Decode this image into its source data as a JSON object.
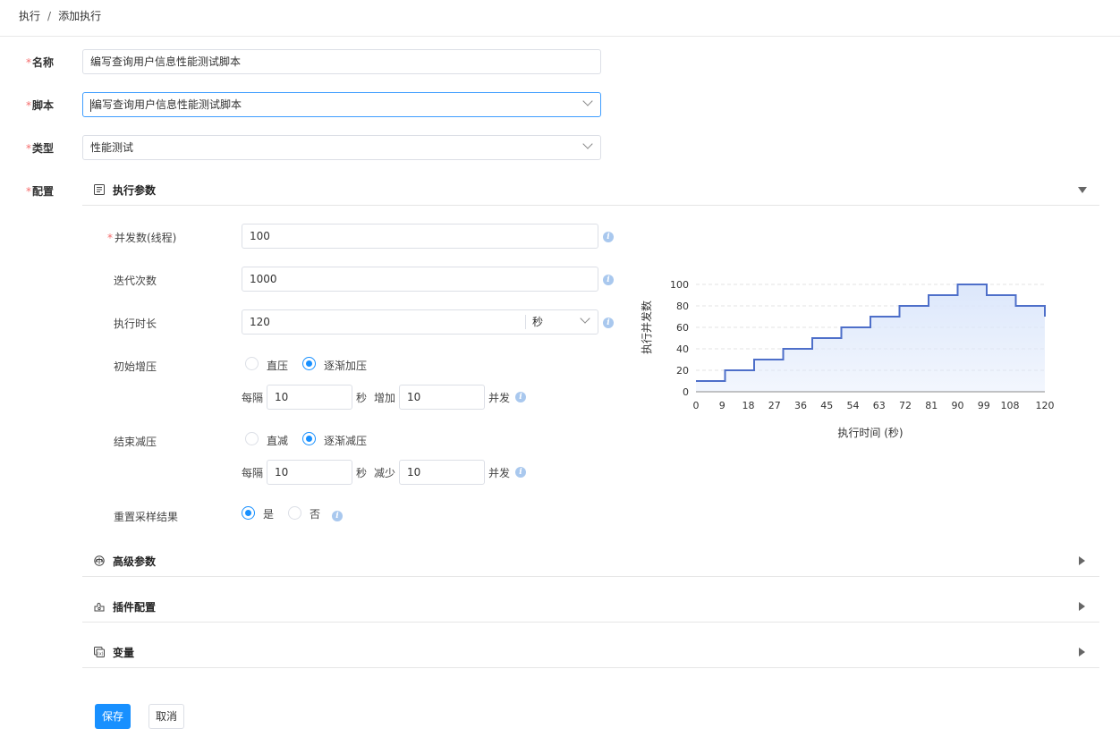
{
  "breadcrumb": {
    "parent": "执行",
    "separator": "/",
    "current": "添加执行"
  },
  "form": {
    "name_label": "名称",
    "name_value": "编写查询用户信息性能测试脚本",
    "script_label": "脚本",
    "script_value": "编写查询用户信息性能测试脚本",
    "type_label": "类型",
    "type_value": "性能测试",
    "config_label": "配置"
  },
  "sections": {
    "exec_params": "执行参数",
    "advanced": "高级参数",
    "plugins": "插件配置",
    "variables": "变量"
  },
  "exec": {
    "concurrency_label": "并发数(线程)",
    "concurrency_value": "100",
    "iterations_label": "迭代次数",
    "iterations_value": "1000",
    "duration_label": "执行时长",
    "duration_value": "120",
    "duration_unit": "秒",
    "ramp_up_label": "初始增压",
    "ramp_up_opt_direct": "直压",
    "ramp_up_opt_gradual": "逐渐加压",
    "ramp_up_every": "每隔",
    "ramp_up_every_value": "10",
    "ramp_up_sec": "秒",
    "ramp_up_add": "增加",
    "ramp_up_add_value": "10",
    "ramp_up_concurrent": "并发",
    "ramp_down_label": "结束减压",
    "ramp_down_opt_direct": "直减",
    "ramp_down_opt_gradual": "逐渐减压",
    "ramp_down_every": "每隔",
    "ramp_down_every_value": "10",
    "ramp_down_sec": "秒",
    "ramp_down_reduce": "减少",
    "ramp_down_reduce_value": "10",
    "ramp_down_concurrent": "并发",
    "reset_label": "重置采样结果",
    "reset_yes": "是",
    "reset_no": "否"
  },
  "buttons": {
    "save": "保存",
    "cancel": "取消"
  },
  "chart_data": {
    "type": "area",
    "step": true,
    "xlabel": "执行时间 (秒)",
    "ylabel": "执行并发数",
    "x_ticks": [
      0,
      9,
      18,
      27,
      36,
      45,
      54,
      63,
      72,
      81,
      90,
      99,
      108,
      120
    ],
    "y_ticks": [
      0,
      20,
      40,
      60,
      80,
      100
    ],
    "xlim": [
      0,
      120
    ],
    "ylim": [
      0,
      100
    ],
    "x": [
      0,
      10,
      20,
      30,
      40,
      50,
      60,
      70,
      80,
      90,
      100,
      110,
      120
    ],
    "values": [
      10,
      20,
      30,
      40,
      50,
      60,
      70,
      80,
      90,
      100,
      90,
      80,
      70
    ],
    "color": "#4e6fc9",
    "fill": "#dce7fb"
  }
}
